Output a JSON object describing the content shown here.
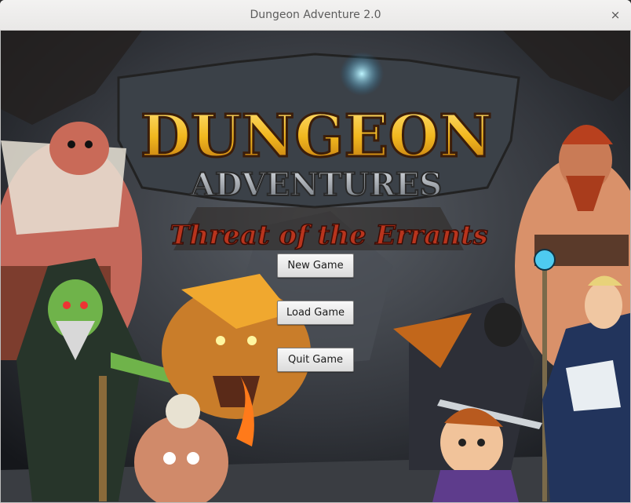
{
  "window": {
    "title": "Dungeon Adventure 2.0",
    "close_glyph": "×"
  },
  "logo": {
    "line1": "DUNGEON",
    "line2": "ADVENTURES",
    "subtitle": "Threat of the Errants"
  },
  "menu": {
    "new_game": "New Game",
    "load_game": "Load Game",
    "quit_game": "Quit Game"
  },
  "icons": {
    "close": "close-icon"
  },
  "colors": {
    "logo_gold": "#f2c02a",
    "logo_outline": "#3b1d0a",
    "subtitle_red": "#b8341d",
    "banner_stone": "#8a8f95",
    "sky": "#2a2e35"
  }
}
